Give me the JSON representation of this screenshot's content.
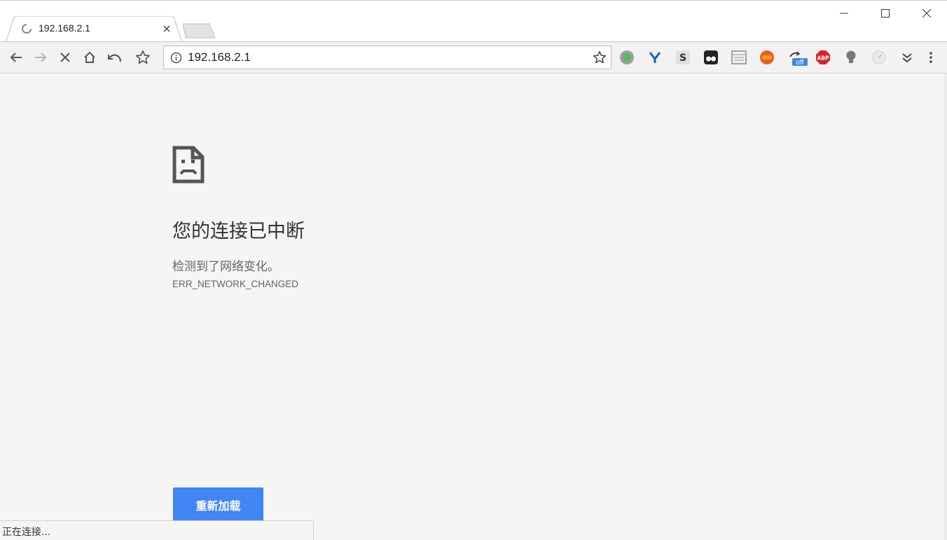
{
  "browser": {
    "tab": {
      "title": "192.168.2.1",
      "loading": true
    },
    "omnibox": {
      "url": "192.168.2.1"
    },
    "toolbar_icons": [
      "back-icon",
      "forward-icon",
      "stop-icon",
      "home-icon",
      "undo-icon",
      "bookmark-star-icon"
    ],
    "extensions": [
      {
        "name": "green-circle-extension-icon"
      },
      {
        "name": "y-extension-icon"
      },
      {
        "name": "s-extension-icon"
      },
      {
        "name": "tampermonkey-extension-icon"
      },
      {
        "name": "window-extension-icon"
      },
      {
        "name": "infinity-extension-icon"
      },
      {
        "name": "off-extension-icon",
        "badge": "off"
      },
      {
        "name": "adblock-plus-extension-icon",
        "label": "ABP"
      },
      {
        "name": "lightbulb-extension-icon"
      },
      {
        "name": "speedometer-extension-icon"
      },
      {
        "name": "overflow-chevron-icon"
      },
      {
        "name": "menu-icon"
      }
    ],
    "status_text": "正在连接..."
  },
  "error_page": {
    "title": "您的连接已中断",
    "description": "检测到了网络变化。",
    "error_code": "ERR_NETWORK_CHANGED",
    "reload_button": "重新加载"
  },
  "colors": {
    "accent": "#4285f4",
    "page_background": "#f5f5f5",
    "text": "#333333",
    "muted_text": "#646464"
  }
}
